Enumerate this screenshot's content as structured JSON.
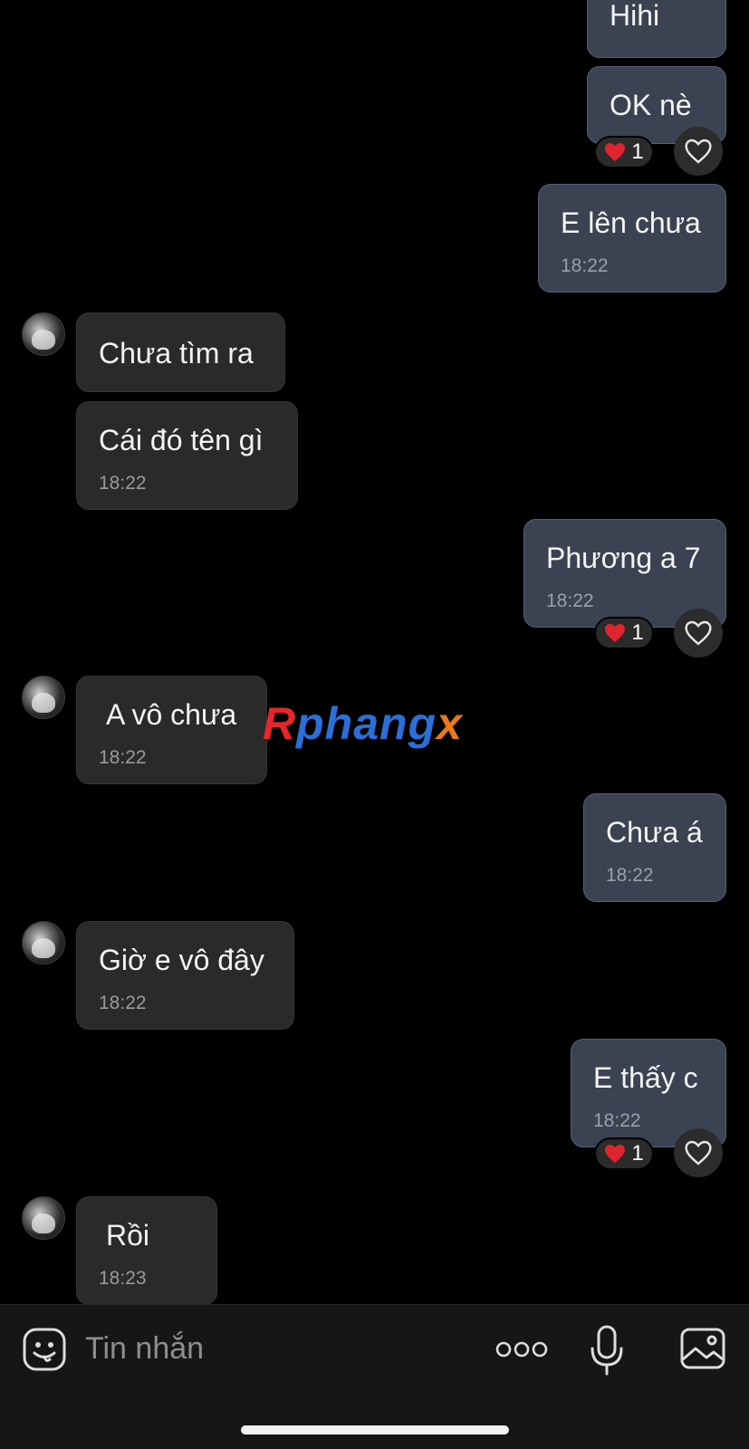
{
  "messages": [
    {
      "id": 1,
      "direction": "sent",
      "text": "Hihi",
      "time": ""
    },
    {
      "id": 2,
      "direction": "sent",
      "text": "OK nè",
      "time": "",
      "reaction": {
        "emoji": "❤️",
        "count": "1"
      }
    },
    {
      "id": 3,
      "direction": "sent",
      "text": "E lên chưa",
      "time": "18:22"
    },
    {
      "id": 4,
      "direction": "received",
      "text": "Chưa tìm ra",
      "time": ""
    },
    {
      "id": 5,
      "direction": "received",
      "text": "Cái đó tên gì",
      "time": "18:22"
    },
    {
      "id": 6,
      "direction": "sent",
      "text": "Phương a 7",
      "time": "18:22",
      "reaction": {
        "emoji": "❤️",
        "count": "1"
      }
    },
    {
      "id": 7,
      "direction": "received",
      "text": "A vô chưa",
      "time": "18:22"
    },
    {
      "id": 8,
      "direction": "sent",
      "text": "Chưa á",
      "time": "18:22"
    },
    {
      "id": 9,
      "direction": "received",
      "text": "Giờ e vô đây",
      "time": "18:22"
    },
    {
      "id": 10,
      "direction": "sent",
      "text": "E thấy c",
      "time": "18:22",
      "reaction": {
        "emoji": "❤️",
        "count": "1"
      }
    },
    {
      "id": 11,
      "direction": "received",
      "text": "Rồi",
      "time": "18:23"
    }
  ],
  "watermark": {
    "part1": "R",
    "part2": "phang",
    "part3": "x"
  },
  "composer": {
    "placeholder": "Tin nhắn"
  },
  "icons": {
    "emoji": "smiley-icon",
    "more": "more-dots-icon",
    "mic": "microphone-icon",
    "image": "image-icon",
    "like": "heart-outline-icon",
    "reaction": "red-heart-icon"
  },
  "colors": {
    "background": "#000000",
    "sent_bubble": "#3b4252",
    "received_bubble": "#2a2a2a",
    "reaction_heart": "#e0242f"
  }
}
